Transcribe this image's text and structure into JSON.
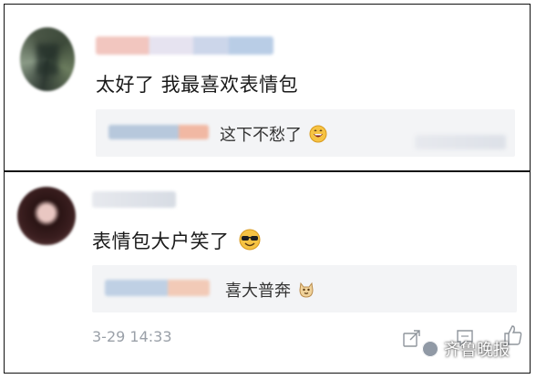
{
  "post1": {
    "comment_text": "太好了 我最喜欢表情包",
    "reply_text": "这下不愁了"
  },
  "post2": {
    "comment_text": "表情包大户笑了",
    "reply_text": "喜大普奔",
    "timestamp": "3-29 14:33"
  },
  "watermark": {
    "text": "齐鲁晚报"
  },
  "icons": {
    "reply1_emoji": "grinning-face-icon",
    "comment2_emoji": "sunglasses-face-icon",
    "reply2_emoji": "doge-face-icon",
    "share": "share-icon",
    "comment": "comment-icon",
    "like": "like-icon"
  }
}
